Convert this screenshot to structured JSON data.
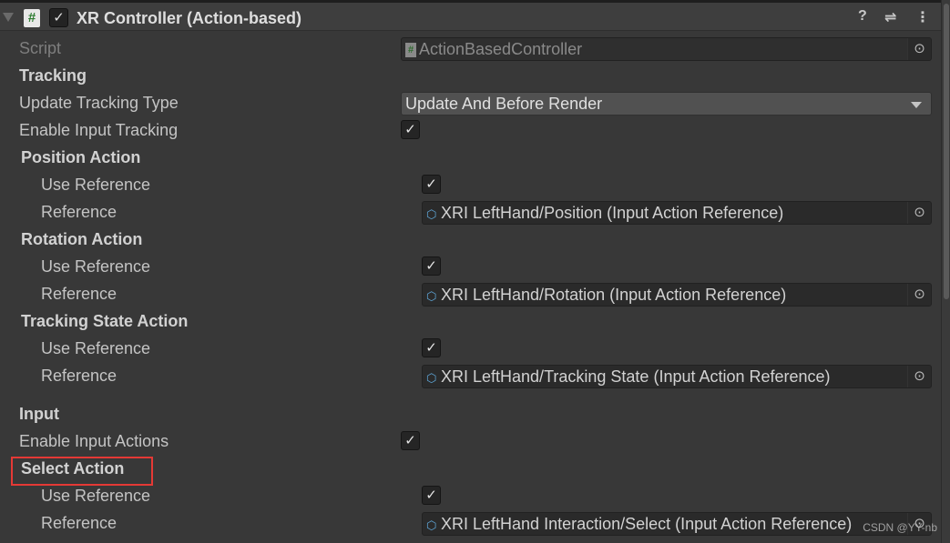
{
  "header": {
    "title": "XR Controller (Action-based)",
    "enabled": true,
    "icons": [
      "foldout-arrow-icon",
      "script-icon",
      "help-icon",
      "preset-icon",
      "more-menu-icon"
    ]
  },
  "rows": [
    {
      "type": "object",
      "label": "Script",
      "value": "ActionBasedController",
      "dim": true,
      "icon": "script-icon"
    },
    {
      "type": "header",
      "label": "Tracking"
    },
    {
      "type": "dropdown",
      "label": "Update Tracking Type",
      "value": "Update And Before Render"
    },
    {
      "type": "check",
      "label": "Enable Input Tracking",
      "checked": true
    },
    {
      "type": "subheader",
      "label": "Position Action"
    },
    {
      "type": "check",
      "label": "Use Reference",
      "checked": true,
      "indent": true
    },
    {
      "type": "object",
      "label": "Reference",
      "value": "XRI LeftHand/Position (Input Action Reference)",
      "indent": true,
      "icon": "input-action-icon"
    },
    {
      "type": "subheader",
      "label": "Rotation Action"
    },
    {
      "type": "check",
      "label": "Use Reference",
      "checked": true,
      "indent": true
    },
    {
      "type": "object",
      "label": "Reference",
      "value": "XRI LeftHand/Rotation (Input Action Reference)",
      "indent": true,
      "icon": "input-action-icon"
    },
    {
      "type": "subheader",
      "label": "Tracking State Action"
    },
    {
      "type": "check",
      "label": "Use Reference",
      "checked": true,
      "indent": true
    },
    {
      "type": "object",
      "label": "Reference",
      "value": "XRI LeftHand/Tracking State (Input Action Reference)",
      "indent": true,
      "icon": "input-action-icon"
    },
    {
      "type": "header",
      "label": "Input"
    },
    {
      "type": "check",
      "label": "Enable Input Actions",
      "checked": true
    },
    {
      "type": "subheader",
      "label": "Select Action",
      "highlighted": true
    },
    {
      "type": "check",
      "label": "Use Reference",
      "checked": true,
      "indent": true
    },
    {
      "type": "object",
      "label": "Reference",
      "value": "XRI LeftHand Interaction/Select (Input Action Reference)",
      "indent": true,
      "icon": "input-action-icon"
    }
  ],
  "watermark": "CSDN @YY-nb",
  "colors": {
    "background": "#383838",
    "highlight": "#e53935"
  }
}
